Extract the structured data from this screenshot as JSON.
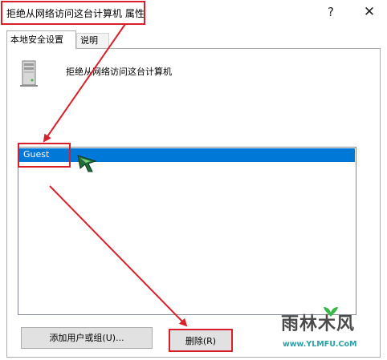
{
  "window": {
    "title": "拒绝从网络访问这台计算机 属性",
    "help_glyph": "?",
    "close_glyph": "✕"
  },
  "tabs": [
    {
      "label": "本地安全设置",
      "active": true
    },
    {
      "label": "说明",
      "active": false
    }
  ],
  "policy": {
    "title": "拒绝从网络访问这台计算机",
    "icon": "server-icon"
  },
  "accounts_list": {
    "items": [
      {
        "label": "Guest",
        "selected": true
      }
    ]
  },
  "buttons": {
    "add_label": "添加用户或组(U)...",
    "delete_label": "删除(R)"
  },
  "watermark": {
    "line1": "雨林木风",
    "line2": "www.YLMFU.CoM"
  },
  "colors": {
    "selection": "#0078d7",
    "annotation_red": "#d9202a",
    "watermark_teal": "#2aa0a6"
  }
}
